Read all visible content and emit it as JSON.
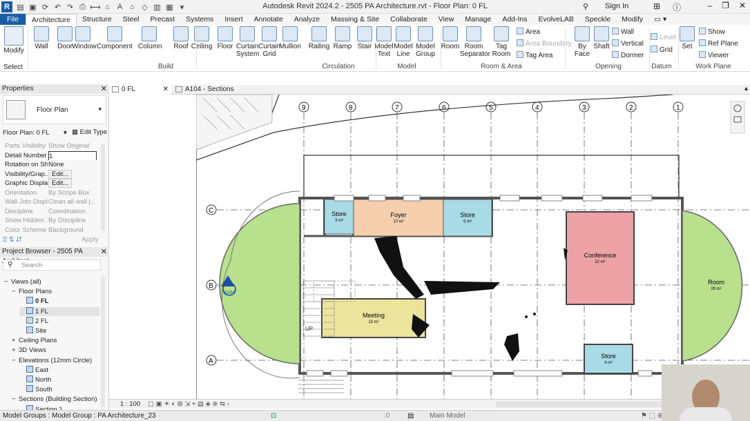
{
  "window": {
    "title": "Autodesk Revit 2024.2 - 2505 PA Architecture.rvt - Floor Plan: 0 FL",
    "sign_in": "Sign In",
    "logo": "R"
  },
  "tabs": [
    "File",
    "Architecture",
    "Structure",
    "Steel",
    "Precast",
    "Systems",
    "Insert",
    "Annotate",
    "Analyze",
    "Massing & Site",
    "Collaborate",
    "View",
    "Manage",
    "Add-Ins",
    "EvolveLAB",
    "Speckle",
    "Modify"
  ],
  "active_tab": "Architecture",
  "ribbon": {
    "select": {
      "modify": "Modify",
      "select": "Select"
    },
    "build": [
      "Wall",
      "Door",
      "Window",
      "Component",
      "Column",
      "Roof",
      "Ceiling",
      "Floor",
      "Curtain System",
      "Curtain Grid",
      "Mullion"
    ],
    "circulation": [
      "Railing",
      "Ramp",
      "Stair"
    ],
    "model": [
      "Model Text",
      "Model Line",
      "Model Group"
    ],
    "room_area": [
      "Room",
      "Room Separator",
      "Tag Room"
    ],
    "room_area_small": {
      "area": "Area",
      "area_boundary": "Area Boundary",
      "tag_area": "Tag Area"
    },
    "opening_big": [
      "By Face",
      "Shaft"
    ],
    "opening_small": [
      "Wall",
      "Vertical",
      "Dormer"
    ],
    "datum": [
      "Level",
      "Grid"
    ],
    "work_plane_big": [
      "Set"
    ],
    "work_plane_small": [
      "Show",
      "Ref Plane",
      "Viewer"
    ],
    "panels": [
      "Build",
      "Circulation",
      "Model",
      "Room & Area",
      "Opening",
      "Datum",
      "Work Plane"
    ]
  },
  "properties": {
    "header": "Properties",
    "type": "Floor Plan",
    "instance": "Floor Plan: 0 FL",
    "edit_type": "Edit Type",
    "rows": [
      {
        "k": "Parts Visibility",
        "v": "Show Original",
        "dim": true
      },
      {
        "k": "Detail Number",
        "v": "1",
        "dim": false
      },
      {
        "k": "Rotation on Sh...",
        "v": "None",
        "dim": false
      },
      {
        "k": "Visibility/Grap...",
        "v": "Edit...",
        "dim": false
      },
      {
        "k": "Graphic Displa...",
        "v": "Edit...",
        "dim": false
      },
      {
        "k": "Orientation",
        "v": "By Scope Box",
        "dim": true
      },
      {
        "k": "Wall Join Displ...",
        "v": "Clean all wall j...",
        "dim": true
      },
      {
        "k": "Discipline",
        "v": "Coordination",
        "dim": true
      },
      {
        "k": "Show Hidden ...",
        "v": "By Discipline",
        "dim": true
      },
      {
        "k": "Color Scheme ...",
        "v": "Background",
        "dim": true
      }
    ],
    "apply": "Apply"
  },
  "browser": {
    "header": "Project Browser - 2505 PA Architect...",
    "search": "Search",
    "items": [
      {
        "t": "Views (all)",
        "d": 0,
        "e": "−"
      },
      {
        "t": "Floor Plans",
        "d": 1,
        "e": "−"
      },
      {
        "t": "0 FL",
        "d": 2,
        "e": "",
        "bold": true
      },
      {
        "t": "1 FL",
        "d": 2,
        "e": "",
        "sel": true
      },
      {
        "t": "2 FL",
        "d": 2,
        "e": ""
      },
      {
        "t": "Site",
        "d": 2,
        "e": ""
      },
      {
        "t": "Ceiling Plans",
        "d": 1,
        "e": "+"
      },
      {
        "t": "3D Views",
        "d": 1,
        "e": "+"
      },
      {
        "t": "Elevations (12mm Circle)",
        "d": 1,
        "e": "−"
      },
      {
        "t": "East",
        "d": 2,
        "e": ""
      },
      {
        "t": "North",
        "d": 2,
        "e": ""
      },
      {
        "t": "South",
        "d": 2,
        "e": ""
      },
      {
        "t": "Sections (Building Section)",
        "d": 1,
        "e": "−"
      },
      {
        "t": "Section 1",
        "d": 2,
        "e": ""
      }
    ]
  },
  "doc_tabs": [
    "0 FL",
    "A104 - Sections"
  ],
  "view_scale": "1 : 100",
  "grids": [
    "9",
    "8",
    "7",
    "6",
    "5",
    "4",
    "3",
    "2",
    "1"
  ],
  "grid_rows": [
    "C",
    "B",
    "A"
  ],
  "section_tag": "A104",
  "stair_label": "UP",
  "rooms": [
    {
      "name": "Store",
      "area": "3 m²",
      "color": "#a9dbe6"
    },
    {
      "name": "Foyer",
      "area": "10 m²",
      "color": "#f5cfae"
    },
    {
      "name": "Store",
      "area": "5 m²",
      "color": "#a9dbe6"
    },
    {
      "name": "Conference",
      "area": "22 m²",
      "color": "#eda3a6"
    },
    {
      "name": "Room",
      "area": "29 m²",
      "color": "#b8e08d"
    },
    {
      "name": "Meeting",
      "area": "13 m²",
      "color": "#ece49c"
    },
    {
      "name": "Store",
      "area": "4 m²",
      "color": "#a9dbe6"
    }
  ],
  "status": {
    "text": "Model Groups : Model Group : PA Architecture_23",
    "zero": ":0",
    "model": "Main Model"
  }
}
